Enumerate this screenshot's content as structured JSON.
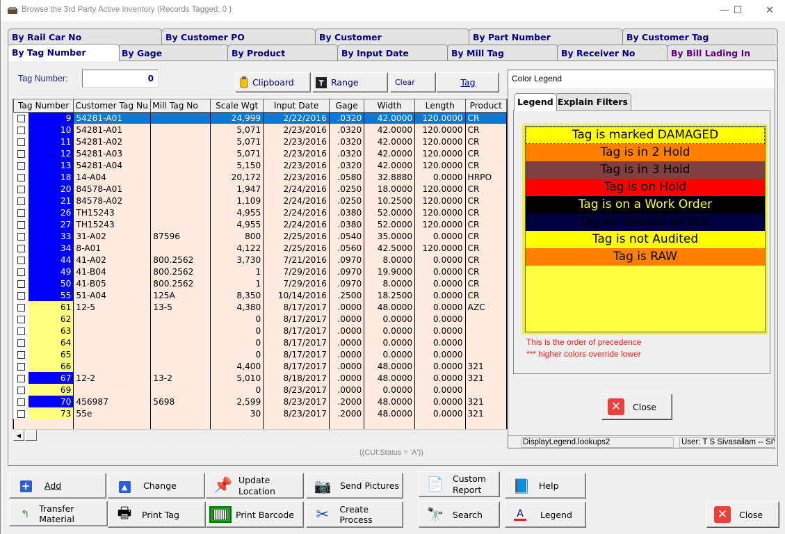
{
  "window": {
    "title": "Browse the 3rd Party Active Inventory  (Records Tagged:  0 )",
    "minimize": "—",
    "maximize": "☐",
    "close": "✕"
  },
  "tabs": {
    "row_back": [
      "By Rail Car No",
      "By Customer PO",
      "By Customer",
      "By Part Number",
      "By Customer Tag"
    ],
    "row_front": [
      "By Tag Number",
      "By Gage",
      "By Product",
      "By Input Date",
      "By Mill Tag",
      "By Receiver No",
      "By Bill Lading In"
    ],
    "active": "By Tag Number"
  },
  "search": {
    "label": "Tag Number:",
    "value": "0"
  },
  "toolbar": {
    "clipboard": "Clipboard",
    "range": "Range",
    "clear": "Clear",
    "tag": "Tag"
  },
  "grid": {
    "columns": [
      "Tag Number",
      "Customer Tag Nu",
      "Mill Tag No",
      "Scale Wgt",
      "Input Date",
      "Gage",
      "Width",
      "Length",
      "Product"
    ],
    "rows": [
      {
        "tag": "9",
        "cust": "54281-A01",
        "mill": "",
        "wgt": "24,999",
        "date": "2/22/2016",
        "gage": ".0320",
        "width": "42.0000",
        "length": "120.0000",
        "product": "CR",
        "color": "blue",
        "selected": true
      },
      {
        "tag": "10",
        "cust": "54281-A01",
        "mill": "",
        "wgt": "5,071",
        "date": "2/23/2016",
        "gage": ".0320",
        "width": "42.0000",
        "length": "120.0000",
        "product": "CR",
        "color": "blue"
      },
      {
        "tag": "11",
        "cust": "54281-A02",
        "mill": "",
        "wgt": "5,071",
        "date": "2/23/2016",
        "gage": ".0320",
        "width": "42.0000",
        "length": "120.0000",
        "product": "CR",
        "color": "blue"
      },
      {
        "tag": "12",
        "cust": "54281-A03",
        "mill": "",
        "wgt": "5,071",
        "date": "2/23/2016",
        "gage": ".0320",
        "width": "42.0000",
        "length": "120.0000",
        "product": "CR",
        "color": "blue"
      },
      {
        "tag": "13",
        "cust": "54281-A04",
        "mill": "",
        "wgt": "5,150",
        "date": "2/23/2016",
        "gage": ".0320",
        "width": "42.0000",
        "length": "120.0000",
        "product": "CR",
        "color": "blue"
      },
      {
        "tag": "18",
        "cust": "14-A04",
        "mill": "",
        "wgt": "20,172",
        "date": "2/23/2016",
        "gage": ".0580",
        "width": "32.8880",
        "length": "0.0000",
        "product": "HRPO",
        "color": "blue"
      },
      {
        "tag": "20",
        "cust": "84578-A01",
        "mill": "",
        "wgt": "1,947",
        "date": "2/24/2016",
        "gage": ".0250",
        "width": "18.0000",
        "length": "120.0000",
        "product": "CR",
        "color": "blue"
      },
      {
        "tag": "21",
        "cust": "84578-A02",
        "mill": "",
        "wgt": "1,109",
        "date": "2/24/2016",
        "gage": ".0250",
        "width": "10.2500",
        "length": "120.0000",
        "product": "CR",
        "color": "blue"
      },
      {
        "tag": "26",
        "cust": "TH15243",
        "mill": "",
        "wgt": "4,955",
        "date": "2/24/2016",
        "gage": ".0380",
        "width": "52.0000",
        "length": "120.0000",
        "product": "CR",
        "color": "blue"
      },
      {
        "tag": "27",
        "cust": "TH15243",
        "mill": "",
        "wgt": "4,955",
        "date": "2/24/2016",
        "gage": ".0380",
        "width": "52.0000",
        "length": "120.0000",
        "product": "CR",
        "color": "blue"
      },
      {
        "tag": "33",
        "cust": "31-A02",
        "mill": "87596",
        "wgt": "800",
        "date": "2/25/2016",
        "gage": ".0540",
        "width": "35.0000",
        "length": "0.0000",
        "product": "CR",
        "color": "blue"
      },
      {
        "tag": "34",
        "cust": "8-A01",
        "mill": "",
        "wgt": "4,122",
        "date": "2/25/2016",
        "gage": ".0560",
        "width": "42.5000",
        "length": "120.0000",
        "product": "CR",
        "color": "blue"
      },
      {
        "tag": "44",
        "cust": "41-A02",
        "mill": "800.2562",
        "wgt": "3,730",
        "date": "7/21/2016",
        "gage": ".0970",
        "width": "8.0000",
        "length": "0.0000",
        "product": "CR",
        "color": "blue"
      },
      {
        "tag": "49",
        "cust": "41-B04",
        "mill": "800.2562",
        "wgt": "1",
        "date": "7/29/2016",
        "gage": ".0970",
        "width": "19.9000",
        "length": "0.0000",
        "product": "CR",
        "color": "blue"
      },
      {
        "tag": "50",
        "cust": "41-B05",
        "mill": "800.2562",
        "wgt": "1",
        "date": "7/29/2016",
        "gage": ".0970",
        "width": "8.0000",
        "length": "0.0000",
        "product": "CR",
        "color": "blue"
      },
      {
        "tag": "55",
        "cust": "51-A04",
        "mill": "125A",
        "wgt": "8,350",
        "date": "10/14/2016",
        "gage": ".2500",
        "width": "18.2500",
        "length": "0.0000",
        "product": "CR",
        "color": "blue"
      },
      {
        "tag": "61",
        "cust": "12-5",
        "mill": "13-5",
        "wgt": "4,380",
        "date": "8/17/2017",
        "gage": ".0000",
        "width": "48.0000",
        "length": "0.0000",
        "product": "AZC",
        "color": "yellow"
      },
      {
        "tag": "62",
        "cust": "",
        "mill": "",
        "wgt": "0",
        "date": "8/17/2017",
        "gage": ".0000",
        "width": "0.0000",
        "length": "0.0000",
        "product": "",
        "color": "yellow"
      },
      {
        "tag": "63",
        "cust": "",
        "mill": "",
        "wgt": "0",
        "date": "8/17/2017",
        "gage": ".0000",
        "width": "0.0000",
        "length": "0.0000",
        "product": "",
        "color": "yellow"
      },
      {
        "tag": "64",
        "cust": "",
        "mill": "",
        "wgt": "0",
        "date": "8/17/2017",
        "gage": ".0000",
        "width": "0.0000",
        "length": "0.0000",
        "product": "",
        "color": "yellow"
      },
      {
        "tag": "65",
        "cust": "",
        "mill": "",
        "wgt": "0",
        "date": "8/17/2017",
        "gage": ".0000",
        "width": "0.0000",
        "length": "0.0000",
        "product": "",
        "color": "yellow"
      },
      {
        "tag": "66",
        "cust": "",
        "mill": "",
        "wgt": "4,400",
        "date": "8/17/2017",
        "gage": ".0000",
        "width": "48.0000",
        "length": "0.0000",
        "product": "321",
        "color": "yellow"
      },
      {
        "tag": "67",
        "cust": "12-2",
        "mill": "13-2",
        "wgt": "5,010",
        "date": "8/18/2017",
        "gage": ".0000",
        "width": "48.0000",
        "length": "0.0000",
        "product": "321",
        "color": "blue"
      },
      {
        "tag": "69",
        "cust": "",
        "mill": "",
        "wgt": "0",
        "date": "8/23/2017",
        "gage": ".0000",
        "width": "0.0000",
        "length": "0.0000",
        "product": "",
        "color": "yellow"
      },
      {
        "tag": "70",
        "cust": "456987",
        "mill": "5698",
        "wgt": "2,599",
        "date": "8/23/2017",
        "gage": ".2000",
        "width": "48.0000",
        "length": "0.0000",
        "product": "321",
        "color": "blue"
      },
      {
        "tag": "73",
        "cust": "55e",
        "mill": "",
        "wgt": "30",
        "date": "8/23/2017",
        "gage": ".2000",
        "width": "48.0000",
        "length": "0.0000",
        "product": "321",
        "color": "yellow"
      }
    ]
  },
  "filter_text": "((CUI:Status = 'A'))",
  "legend": {
    "title": "Color Legend",
    "tabs": [
      "Legend",
      "Explain Filters"
    ],
    "items": [
      {
        "label": "Tag is marked DAMAGED",
        "bg": "#ffff00",
        "fg": "#000000"
      },
      {
        "label": "Tag is in 2 Hold",
        "bg": "#ff8000",
        "fg": "#000000"
      },
      {
        "label": "Tag is in 3 Hold",
        "bg": "#804040",
        "fg": "#000000"
      },
      {
        "label": "Tag is on Hold",
        "bg": "#ff0000",
        "fg": "#000000"
      },
      {
        "label": "Tag is on a Work Order",
        "bg": "#000000",
        "fg": "#ffff40"
      },
      {
        "label": "Tag on Release or BOL",
        "bg": "#000040",
        "fg": "#000000"
      },
      {
        "label": "Tag is not Audited",
        "bg": "#ffff00",
        "fg": "#000000"
      },
      {
        "label": "Tag is RAW",
        "bg": "#ff8000",
        "fg": "#000000"
      }
    ],
    "note1": "This is the order of precedence",
    "note2": "*** higher colors override lower",
    "close": "Close",
    "status_left": "DisplayLegend.lookups2",
    "status_right": "User: T S Sivasailam -- SIV"
  },
  "actions": {
    "add": "Add",
    "change": "Change",
    "update_location": [
      "Update",
      "Location"
    ],
    "send_pictures": "Send Pictures",
    "custom_report": [
      "Custom",
      "Report"
    ],
    "help": "Help",
    "transfer_material": "Transfer Material",
    "print_tag": "Print Tag",
    "print_barcode": "Print Barcode",
    "create_process": "Create Process",
    "search": "Search",
    "legend": "Legend",
    "close": "Close"
  },
  "colors": {
    "tag_blue": "#0000ff",
    "tag_yellow": "#ffff80",
    "row_bg": "#fdebe0",
    "selected": "#0a78d7",
    "tab_text": "#00007f"
  }
}
